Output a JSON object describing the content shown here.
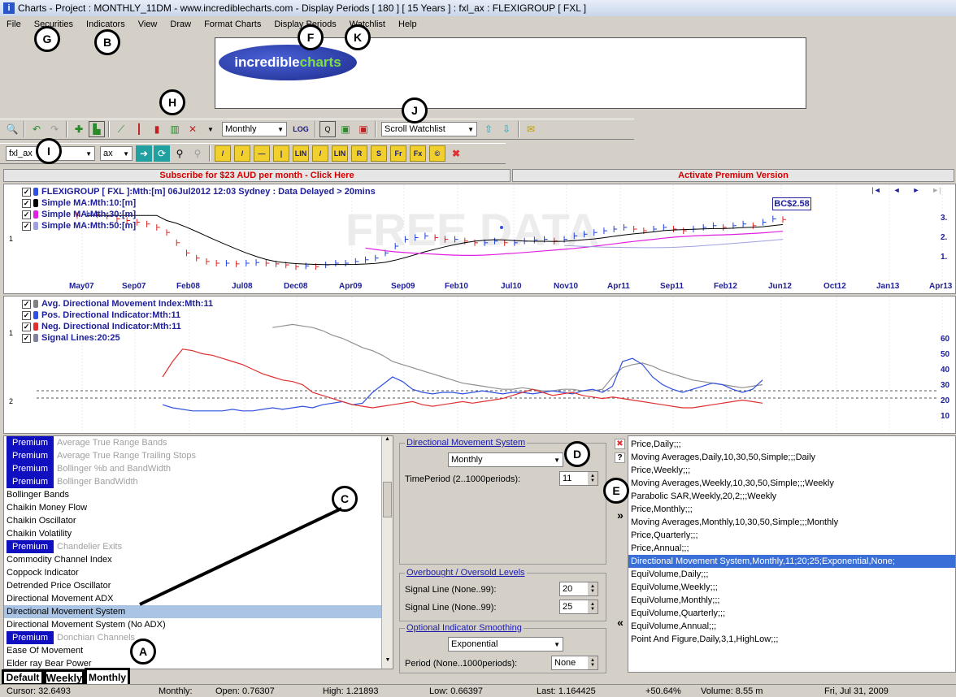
{
  "window": {
    "title": "Charts - Project : MONTHLY_11DM - www.incrediblecharts.com - Display Periods  [ 180 ]  [ 15 Years ] : fxl_ax : FLEXIGROUP  [ FXL ]"
  },
  "menu": [
    "File",
    "Securities",
    "Indicators",
    "View",
    "Draw",
    "Format Charts",
    "Display Periods",
    "Watchlist",
    "Help"
  ],
  "logo": {
    "part1": "incredible",
    "part2": "charts"
  },
  "toolbar": {
    "period_select": "Monthly",
    "log_label": "LOG",
    "watchlist_select": "Scroll Watchlist",
    "symbol_input": "fxl_ax",
    "exchange_select": "ax",
    "drawing_tools": [
      "/",
      "/",
      "—",
      "|",
      "LIN",
      "/",
      "LIN",
      "R",
      "S",
      "Fr",
      "Fx",
      "©",
      "✖"
    ]
  },
  "banners": {
    "subscribe": "Subscribe for $23 AUD per month - Click Here",
    "activate": "Activate Premium Version"
  },
  "price_chart": {
    "legend": [
      {
        "label": "FLEXIGROUP [ FXL ]:Mth:[m]  06Jul2012 12:03 Sydney : Data Delayed > 20mins",
        "color": "#3050e0"
      },
      {
        "label": "Simple MA:Mth:10:[m]",
        "color": "#000000"
      },
      {
        "label": "Simple MA:Mth:30:[m]",
        "color": "#e020e0"
      },
      {
        "label": "Simple MA:Mth:50:[m]",
        "color": "#a0a0e0"
      }
    ],
    "watermark": "FREE DATA",
    "price_badge": "BC$2.58",
    "y_ticks": [
      "3.",
      "2.",
      "1."
    ],
    "panel_number": "1",
    "x_ticks": [
      "May07",
      "Sep07",
      "Feb08",
      "Jul08",
      "Dec08",
      "Apr09",
      "Sep09",
      "Feb10",
      "Jul10",
      "Nov10",
      "Apr11",
      "Sep11",
      "Feb12",
      "Jun12",
      "Oct12",
      "Jan13",
      "Apr13"
    ]
  },
  "indicator_chart": {
    "legend": [
      {
        "label": "Avg. Directional Movement Index:Mth:11",
        "color": "#808080"
      },
      {
        "label": "Pos. Directional Indicator:Mth:11",
        "color": "#3050e0"
      },
      {
        "label": "Neg. Directional Indicator:Mth:11",
        "color": "#e03030"
      },
      {
        "label": "Signal Lines:20:25",
        "color": "#8080a0"
      }
    ],
    "y_ticks": [
      "60",
      "50",
      "40",
      "30",
      "20",
      "10"
    ],
    "panel_numbers": [
      "1",
      "2"
    ]
  },
  "indicator_list": [
    {
      "label": "Average True Range Bands",
      "premium": true
    },
    {
      "label": "Average True Range Trailing Stops",
      "premium": true
    },
    {
      "label": "Bollinger %b and BandWidth",
      "premium": true
    },
    {
      "label": "Bollinger BandWidth",
      "premium": true
    },
    {
      "label": "Bollinger Bands",
      "premium": false
    },
    {
      "label": "Chaikin Money Flow",
      "premium": false
    },
    {
      "label": "Chaikin Oscillator",
      "premium": false
    },
    {
      "label": "Chaikin Volatility",
      "premium": false
    },
    {
      "label": "Chandelier Exits",
      "premium": true
    },
    {
      "label": "Commodity Channel Index",
      "premium": false
    },
    {
      "label": "Coppock Indicator",
      "premium": false
    },
    {
      "label": "Detrended Price Oscillator",
      "premium": false
    },
    {
      "label": "Directional Movement ADX",
      "premium": false
    },
    {
      "label": "Directional Movement System",
      "premium": false,
      "selected": true
    },
    {
      "label": "Directional Movement System (No ADX)",
      "premium": false
    },
    {
      "label": "Donchian Channels",
      "premium": true
    },
    {
      "label": "Ease Of Movement",
      "premium": false
    },
    {
      "label": "Elder ray Bear Power",
      "premium": false
    }
  ],
  "premium_badge": "Premium",
  "settings": {
    "dms_title": "Directional Movement System",
    "dms_period": "Monthly",
    "time_period_label": "TimePeriod (2..1000periods):",
    "time_period_value": "11",
    "ob_os_title": "Overbought / Oversold Levels",
    "signal_line1_label": "Signal Line (None..99):",
    "signal_line1_value": "20",
    "signal_line2_label": "Signal Line (None..99):",
    "signal_line2_value": "25",
    "smoothing_title": "Optional Indicator Smoothing",
    "smoothing_type": "Exponential",
    "smoothing_period_label": "Period (None..1000periods):",
    "smoothing_period_value": "None"
  },
  "side_buttons": {
    "delete": "✖",
    "help": "?",
    "add": "»",
    "remove": "«"
  },
  "parameter_list": [
    {
      "label": "Price,Daily;;;"
    },
    {
      "label": "Moving Averages,Daily,10,30,50,Simple;;;Daily"
    },
    {
      "label": "Price,Weekly;;;"
    },
    {
      "label": "Moving Averages,Weekly,10,30,50,Simple;;;Weekly"
    },
    {
      "label": "Parabolic SAR,Weekly,20,2;;;Weekly"
    },
    {
      "label": "Price,Monthly;;;"
    },
    {
      "label": "Moving Averages,Monthly,10,30,50,Simple;;;Monthly"
    },
    {
      "label": "Price,Quarterly;;;"
    },
    {
      "label": "Price,Annual;;;"
    },
    {
      "label": "Directional Movement System,Monthly,11;20;25;Exponential,None;",
      "selected": true
    },
    {
      "label": "EquiVolume,Daily;;;"
    },
    {
      "label": "EquiVolume,Weekly;;;"
    },
    {
      "label": "EquiVolume,Monthly;;;"
    },
    {
      "label": "EquiVolume,Quarterly;;;"
    },
    {
      "label": "EquiVolume,Annual;;;"
    },
    {
      "label": "Point And Figure,Daily,3,1,HighLow;;;"
    }
  ],
  "tabs": [
    "Default",
    "Weekly",
    "Monthly"
  ],
  "status": {
    "cursor": "Cursor: 32.6493",
    "period": "Monthly:",
    "open": "Open: 0.76307",
    "high": "High: 1.21893",
    "low": "Low: 0.66397",
    "last": "Last: 1.164425",
    "change": "+50.64%",
    "volume": "Volume: 8.55 m",
    "date": "Fri, Jul 31, 2009"
  },
  "markers": [
    "G",
    "B",
    "F",
    "K",
    "H",
    "J",
    "I",
    "C",
    "D",
    "E",
    "A"
  ]
}
